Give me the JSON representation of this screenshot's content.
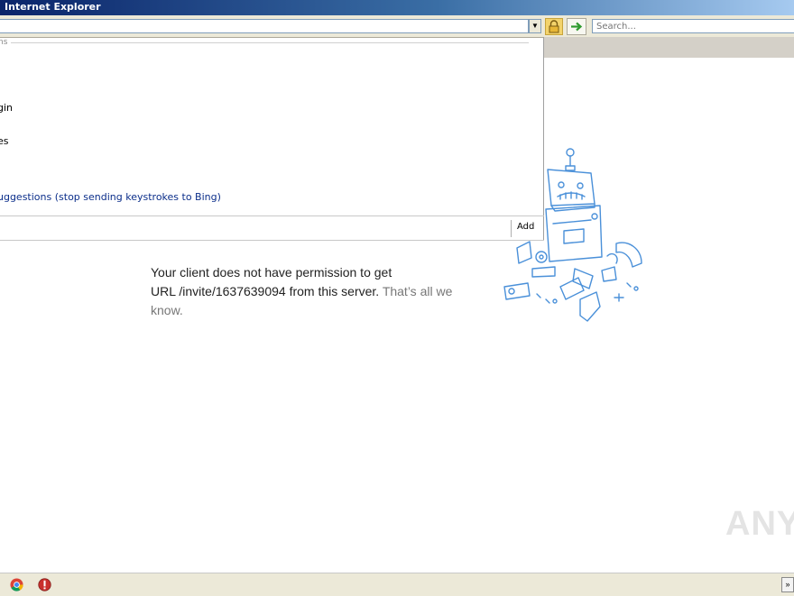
{
  "window": {
    "title": "Internet Explorer"
  },
  "toolbar": {
    "address_value": "",
    "dropdown_glyph": "▼",
    "search_placeholder": "Search...",
    "lock_icon": "lock-icon",
    "go_icon": "go-arrow-icon"
  },
  "dropdown_panel": {
    "section_label": "ns",
    "items": [
      "gin",
      "es"
    ],
    "suggestion_link": "uggestions (stop sending keystrokes to Bing)",
    "add_label": "Add"
  },
  "error": {
    "line1": "Your client does not have permission to get",
    "line2": "URL /invite/1637639094 from this server.",
    "muted1": "That’s all we",
    "muted2": "know."
  },
  "watermark": {
    "text": "ANY"
  },
  "taskbar": {
    "icons": [
      "chrome-icon",
      "stop-icon"
    ],
    "tray_glyph": "»"
  },
  "colors": {
    "title_gradient_start": "#0a246a",
    "title_gradient_end": "#a6caf0",
    "robot_stroke": "#4a90d9",
    "link": "#0b2e8a",
    "muted_text": "#777777"
  }
}
